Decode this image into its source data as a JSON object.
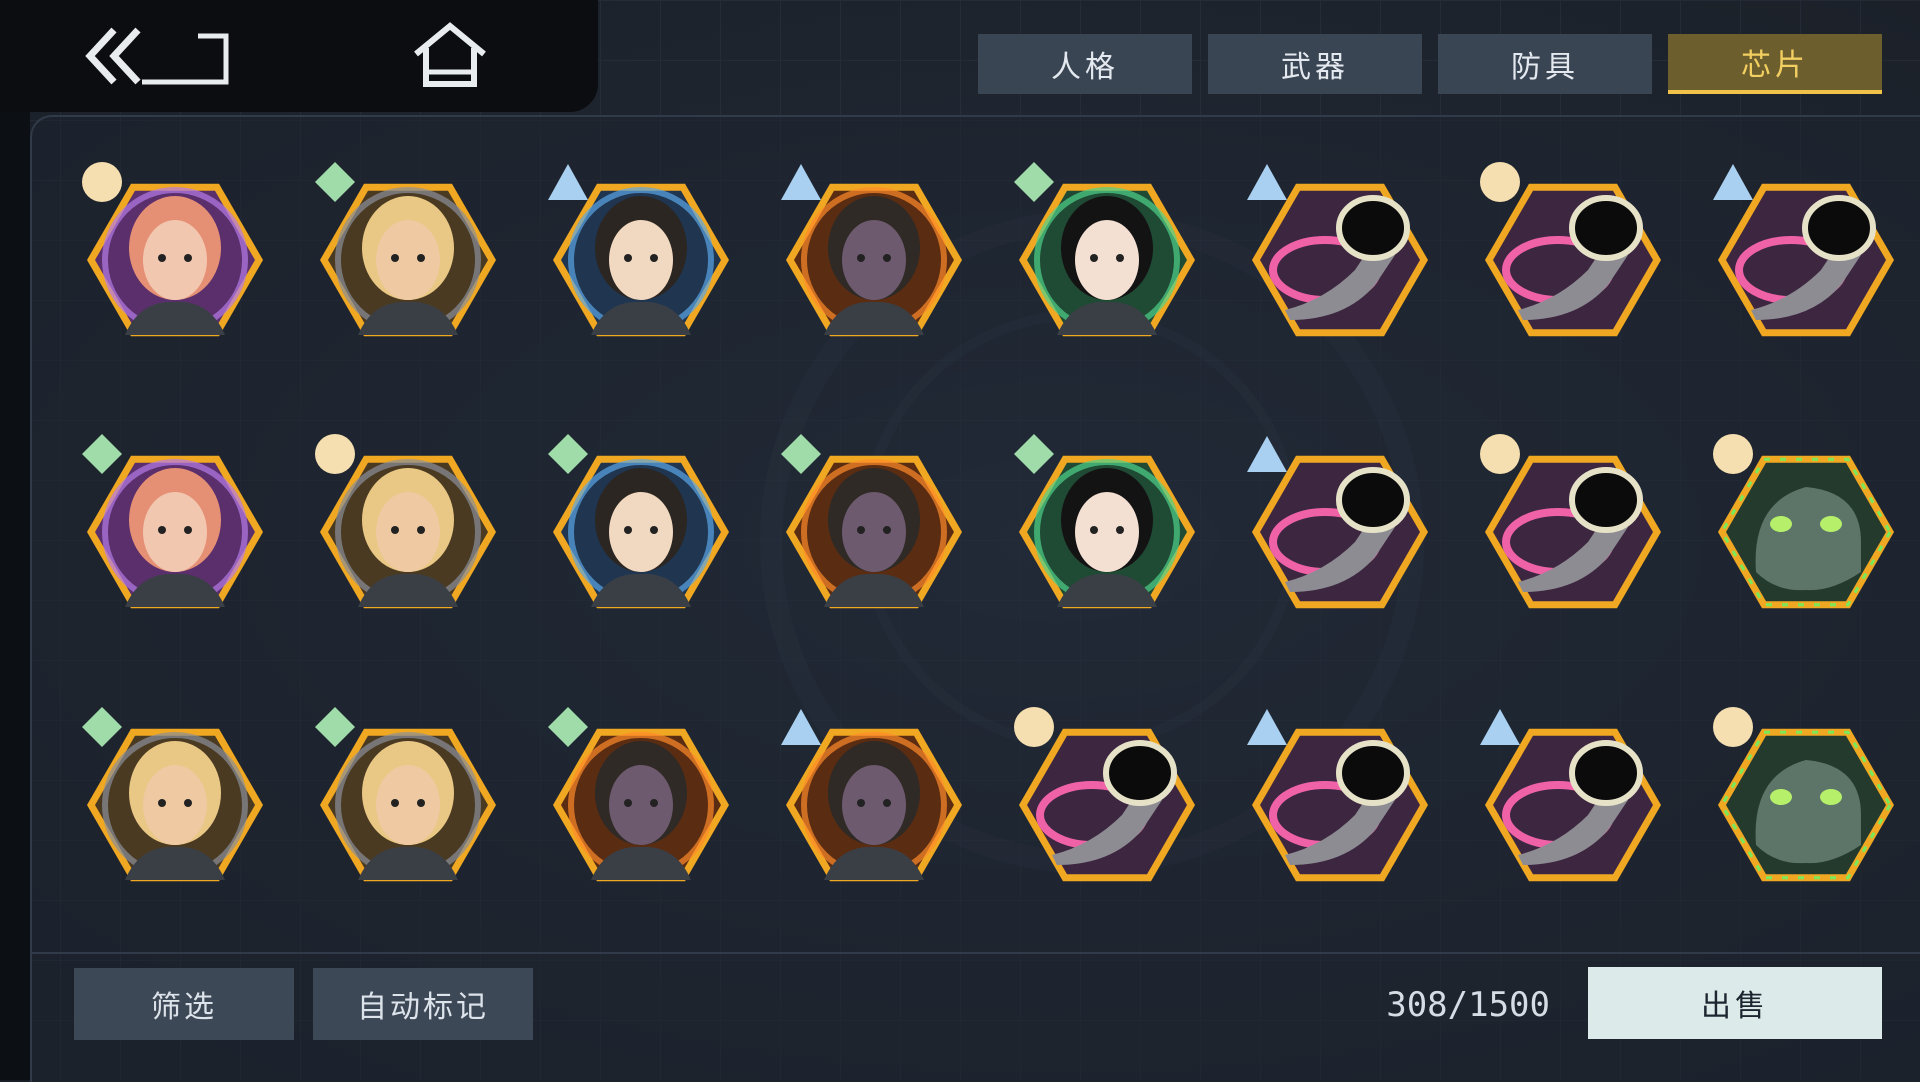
{
  "nav": {
    "back_icon": "double-chevron-left-icon",
    "home_icon": "home-icon"
  },
  "tabs": [
    {
      "label": "人格",
      "active": false
    },
    {
      "label": "武器",
      "active": false
    },
    {
      "label": "防具",
      "active": false
    },
    {
      "label": "芯片",
      "active": true
    }
  ],
  "colors": {
    "tab_active_text": "#f3cf62",
    "hex_gold": "#f0a822",
    "badge_circle": "#f5dfb0",
    "badge_diamond": "#9fdcaa",
    "badge_triangle": "#a9d0f0",
    "sell_button": "#dcebea"
  },
  "chips": [
    {
      "portrait": "pink-hair-woman",
      "rarity": "circle"
    },
    {
      "portrait": "blonde-warrior",
      "rarity": "diamond"
    },
    {
      "portrait": "dark-hair-man-water",
      "rarity": "triangle"
    },
    {
      "portrait": "dark-skin-fire-man",
      "rarity": "triangle"
    },
    {
      "portrait": "black-hair-woman-green",
      "rarity": "diamond"
    },
    {
      "portrait": "horn",
      "rarity": "triangle"
    },
    {
      "portrait": "horn",
      "rarity": "circle"
    },
    {
      "portrait": "horn",
      "rarity": "triangle"
    },
    {
      "portrait": "pink-hair-woman",
      "rarity": "diamond"
    },
    {
      "portrait": "blonde-warrior",
      "rarity": "circle"
    },
    {
      "portrait": "dark-hair-man-water",
      "rarity": "diamond"
    },
    {
      "portrait": "dark-skin-fire-man",
      "rarity": "diamond"
    },
    {
      "portrait": "black-hair-woman-green",
      "rarity": "diamond"
    },
    {
      "portrait": "horn",
      "rarity": "triangle"
    },
    {
      "portrait": "horn",
      "rarity": "circle"
    },
    {
      "portrait": "green-dragon",
      "rarity": "circle"
    },
    {
      "portrait": "blonde-warrior",
      "rarity": "diamond"
    },
    {
      "portrait": "blonde-warrior",
      "rarity": "diamond"
    },
    {
      "portrait": "dark-skin-fire-man",
      "rarity": "diamond"
    },
    {
      "portrait": "dark-skin-fire-man",
      "rarity": "triangle"
    },
    {
      "portrait": "horn",
      "rarity": "circle"
    },
    {
      "portrait": "horn",
      "rarity": "triangle"
    },
    {
      "portrait": "horn",
      "rarity": "triangle"
    },
    {
      "portrait": "green-dragon",
      "rarity": "circle"
    }
  ],
  "bottom": {
    "filter_label": "筛选",
    "auto_mark_label": "自动标记",
    "count_text": "308/1500",
    "sell_label": "出售"
  }
}
